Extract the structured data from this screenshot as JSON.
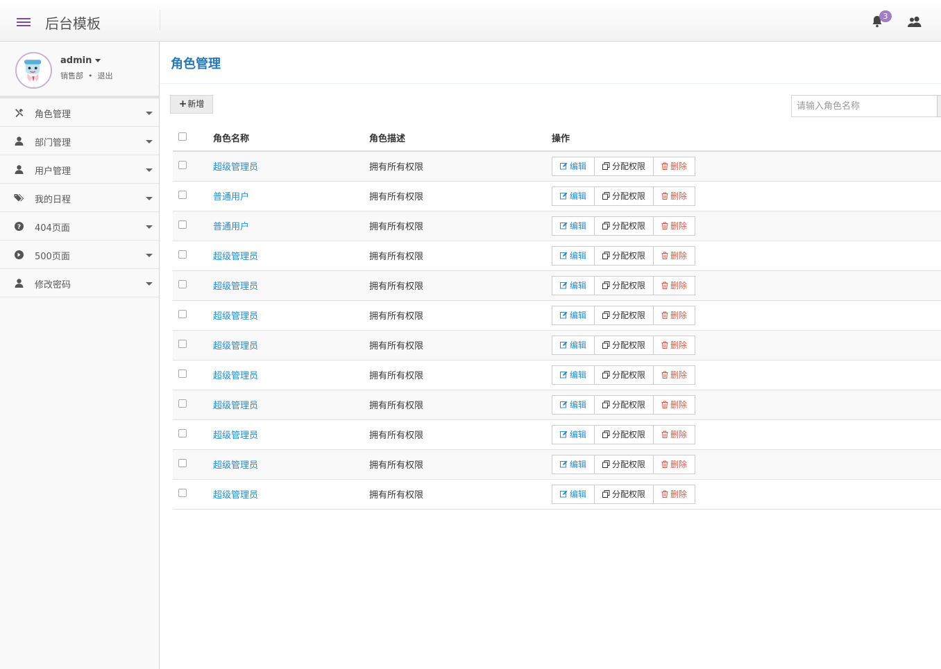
{
  "header": {
    "brand": "后台模板",
    "notification_count": "3"
  },
  "user": {
    "name": "admin",
    "department": "销售部",
    "logout": "退出"
  },
  "sidebar": {
    "items": [
      {
        "label": "角色管理",
        "icon": "wrench-icon"
      },
      {
        "label": "部门管理",
        "icon": "user-icon"
      },
      {
        "label": "用户管理",
        "icon": "user-icon"
      },
      {
        "label": "我的日程",
        "icon": "tags-icon"
      },
      {
        "label": "404页面",
        "icon": "question-circle-icon"
      },
      {
        "label": "500页面",
        "icon": "arrow-circle-icon"
      },
      {
        "label": "修改密码",
        "icon": "user-icon"
      }
    ]
  },
  "main": {
    "title": "角色管理",
    "add_label": "新增",
    "search_placeholder": "请输入角色名称",
    "columns": {
      "name": "角色名称",
      "desc": "角色描述",
      "ops": "操作"
    },
    "buttons": {
      "edit": "编辑",
      "assign": "分配权限",
      "delete": "删除"
    },
    "rows": [
      {
        "name": "超级管理员",
        "desc": "拥有所有权限"
      },
      {
        "name": "普通用户",
        "desc": "拥有所有权限"
      },
      {
        "name": "普通用户",
        "desc": "拥有所有权限"
      },
      {
        "name": "超级管理员",
        "desc": "拥有所有权限"
      },
      {
        "name": "超级管理员",
        "desc": "拥有所有权限"
      },
      {
        "name": "超级管理员",
        "desc": "拥有所有权限"
      },
      {
        "name": "超级管理员",
        "desc": "拥有所有权限"
      },
      {
        "name": "超级管理员",
        "desc": "拥有所有权限"
      },
      {
        "name": "超级管理员",
        "desc": "拥有所有权限"
      },
      {
        "name": "超级管理员",
        "desc": "拥有所有权限"
      },
      {
        "name": "超级管理员",
        "desc": "拥有所有权限"
      },
      {
        "name": "超级管理员",
        "desc": "拥有所有权限"
      }
    ]
  },
  "colors": {
    "accent": "#2679b5",
    "link": "#2a8bcb",
    "danger": "#d15b47",
    "badge": "#a27ec3"
  }
}
